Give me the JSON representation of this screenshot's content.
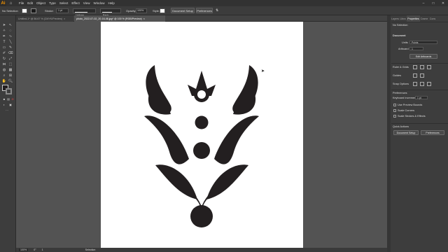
{
  "menubar": {
    "logo": "Ai",
    "items": [
      "File",
      "Edit",
      "Object",
      "Type",
      "Select",
      "Effect",
      "View",
      "Window",
      "Help"
    ]
  },
  "control": {
    "selection_label": "No Selection",
    "stroke_label": "Stroke:",
    "stroke_value": "1 pt",
    "uniform_label": "Uniform",
    "brush_label": "Basic",
    "opacity_label": "Opacity:",
    "opacity_value": "100%",
    "style_label": "Style:",
    "document_setup": "Document Setup",
    "preferences": "Preferences"
  },
  "tabs": [
    {
      "label": "Untitled-1* @ 56.67 % (CMYK/Preview)",
      "active": false
    },
    {
      "label": "photo_2022-07-02_20-16-46.jpg* @ 100 % (RGB/Preview)",
      "active": true
    }
  ],
  "panel": {
    "tabs": [
      "Layers",
      "Libra",
      "Properties",
      "Crame",
      "Cons"
    ],
    "no_selection": "No Selection",
    "document_header": "Document",
    "units_label": "Units",
    "units_value": "Points",
    "artboard_label": "Artboard",
    "artboard_value": "1",
    "edit_artboards": "Edit Artboards",
    "ruler_grids": "Ruler & Grids",
    "guides": "Guides",
    "snap_options": "Snap Options",
    "preferences_header": "Preferences",
    "keyboard_increment_label": "Keyboard Increment",
    "keyboard_increment_value": "1 pt",
    "use_preview_bounds": "Use Preview Bounds",
    "scale_corners": "Scale Corners",
    "scale_strokes": "Scale Strokes & Effects",
    "quick_actions": "Quick Actions",
    "qa_document_setup": "Document Setup",
    "qa_preferences": "Preferences"
  },
  "status": {
    "zoom": "100%",
    "angle": "0°",
    "artboard_num": "1",
    "mode": "Selection"
  },
  "colors": {
    "artwork": "#231f20",
    "accent": "#ff9a00"
  }
}
